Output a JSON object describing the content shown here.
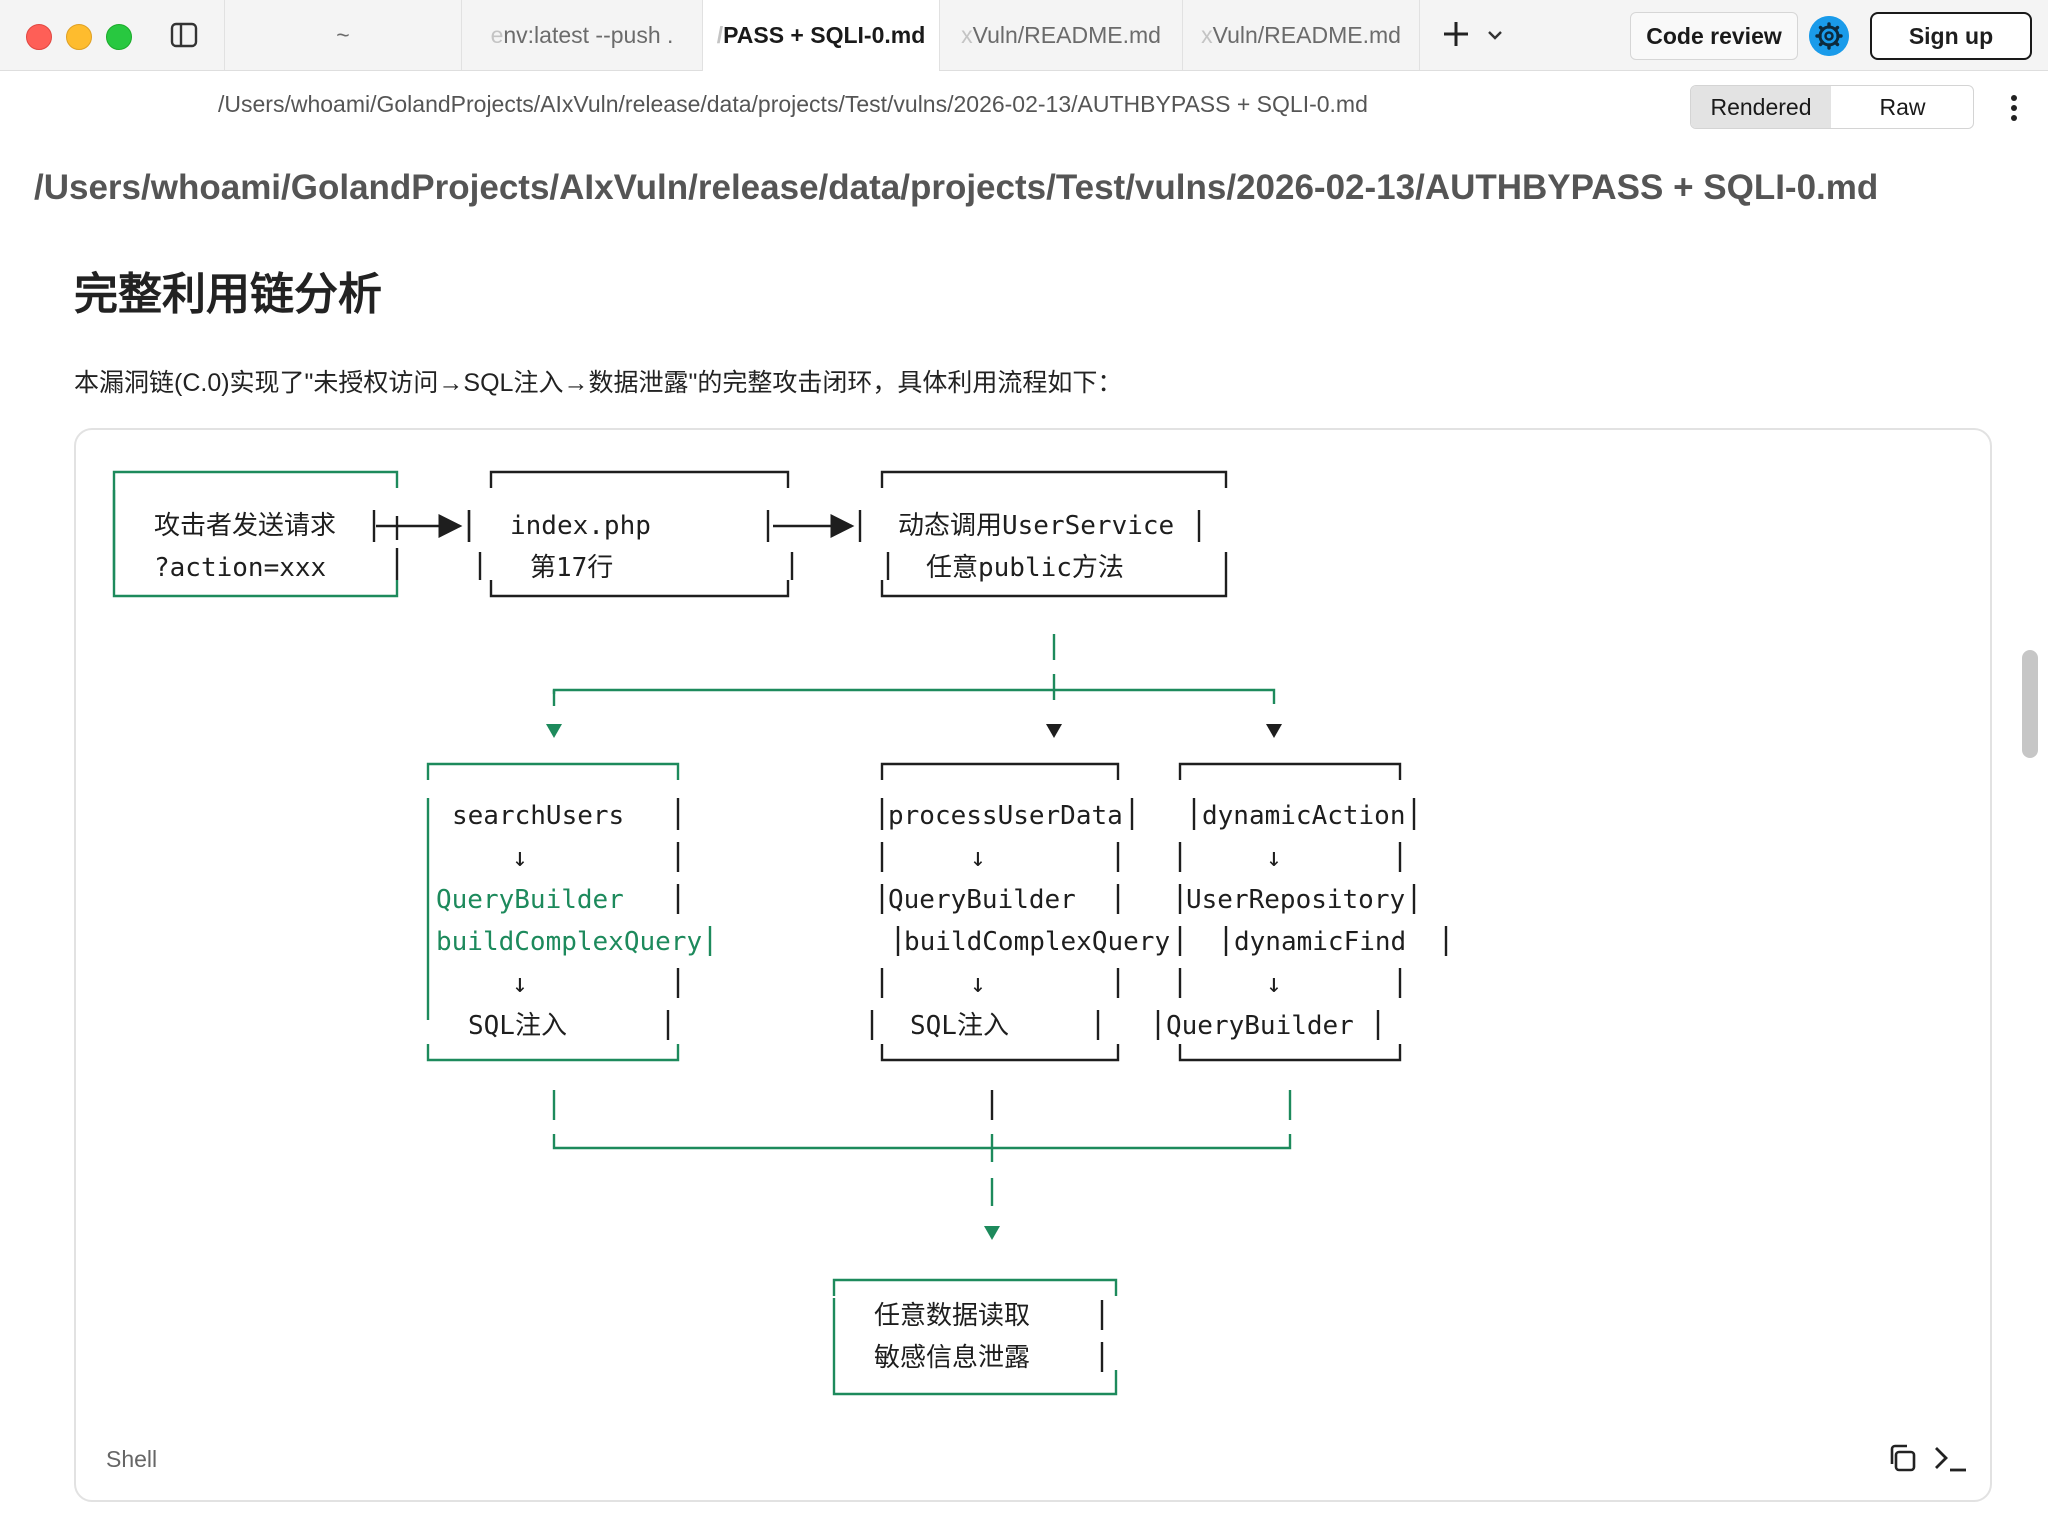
{
  "tabs": {
    "home": "~",
    "tab2_fade": "e",
    "tab2": "nv:latest   --push .",
    "tab3_fade": "/",
    "tab3": "PASS + SQLI-0.md",
    "tab4_fade": "x",
    "tab4": "Vuln/README.md",
    "tab5_fade": "x",
    "tab5": "Vuln/README.md"
  },
  "toolbar": {
    "code_review": "Code review",
    "sign_up": "Sign up"
  },
  "pathbar": {
    "path": "/Users/whoami/GolandProjects/AIxVuln/release/data/projects/Test/vulns/2026-02-13/AUTHBYPASS + SQLI-0.md",
    "rendered": "Rendered",
    "raw": "Raw"
  },
  "doc": {
    "path_heading": "/Users/whoami/GolandProjects/AIxVuln/release/data/projects/Test/vulns/2026-02-13/AUTHBYPASS + SQLI-0.md",
    "section_title": "完整利用链分析",
    "intro": "本漏洞链(C.0)实现了\"未授权访问→SQL注入→数据泄露\"的完整攻击闭环，具体利用流程如下："
  },
  "code": {
    "language": "Shell"
  },
  "diagram": {
    "box_attacker": [
      "攻击者发送请求",
      "?action=xxx"
    ],
    "box_index": [
      "index.php",
      "第17行"
    ],
    "box_dynamic": [
      "动态调用UserService",
      "任意public方法"
    ],
    "box_search": [
      "searchUsers",
      "↓",
      "QueryBuilder",
      "buildComplexQuery",
      "↓",
      "SQL注入"
    ],
    "box_process": [
      "processUserData",
      "↓",
      "QueryBuilder",
      "buildComplexQuery",
      "↓",
      "SQL注入"
    ],
    "box_dynamic_action": [
      "dynamicAction",
      "↓",
      "UserRepository",
      "dynamicFind",
      "↓",
      "QueryBuilder"
    ],
    "box_result": [
      "任意数据读取",
      "敏感信息泄露"
    ]
  },
  "icons": {
    "sidebar": "sidebar-toggle-icon",
    "plus": "plus-icon",
    "chevron": "chevron-down-icon",
    "gear": "gear-icon",
    "kebab": "more-vertical-icon",
    "copy": "copy-icon",
    "terminal": "terminal-icon"
  },
  "colors": {
    "accent_green": "#1d8a5c",
    "gear_blue": "#1a9bea",
    "traffic_red": "#fe5f57",
    "traffic_yellow": "#febc2e",
    "traffic_green": "#28c840"
  }
}
